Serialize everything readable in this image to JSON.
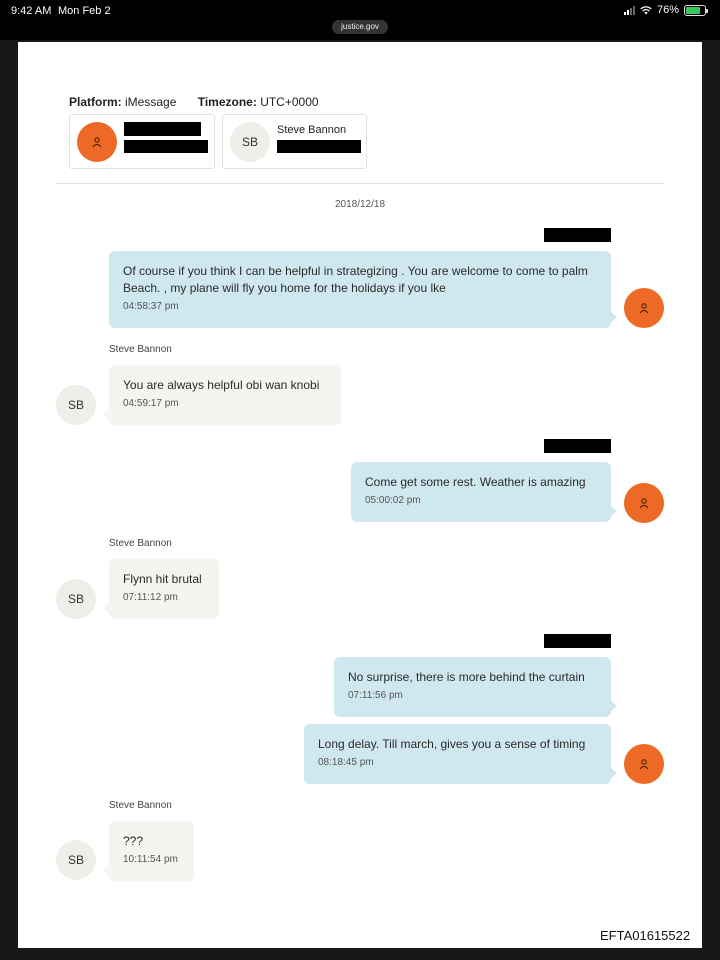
{
  "status_bar": {
    "time": "9:42 AM",
    "date": "Mon Feb 2",
    "url": "justice.gov",
    "battery": "76%",
    "battery_level": 0.76
  },
  "header": {
    "platform_label": "Platform:",
    "platform_value": "iMessage",
    "timezone_label": "Timezone:",
    "timezone_value": "UTC+0000"
  },
  "participants": [
    {
      "initials": "",
      "name": ""
    },
    {
      "initials": "SB",
      "name": "Steve Bannon"
    }
  ],
  "conversation_date": "2018/12/18",
  "messages": [
    {
      "direction": "outgoing",
      "sender": "",
      "text": "Of course if you think I can be helpful in strategizing .  You are welcome to come to palm Beach. , my plane will fly you home for the holidays if you lke",
      "time": "04:58:37 pm"
    },
    {
      "direction": "incoming",
      "sender": "Steve Bannon",
      "text": "You are always helpful obi wan knobi",
      "time": "04:59:17 pm",
      "initials": "SB"
    },
    {
      "direction": "outgoing",
      "sender": "",
      "text": "Come get some rest.    Weather is amazing",
      "time": "05:00:02 pm"
    },
    {
      "direction": "incoming",
      "sender": "Steve Bannon",
      "text": "Flynn hit brutal",
      "time": "07:11:12 pm",
      "initials": "SB"
    },
    {
      "direction": "outgoing",
      "sender": "",
      "text": "No surprise,  there is more behind the curtain",
      "time": "07:11:56 pm"
    },
    {
      "direction": "outgoing",
      "sender": "",
      "text": "Long delay.  Till march,   gives you a sense of timing",
      "time": "08:18:45 pm"
    },
    {
      "direction": "incoming",
      "sender": "Steve Bannon",
      "text": "???",
      "time": "10:11:54 pm",
      "initials": "SB"
    }
  ],
  "document_id": "EFTA01615522",
  "colors": {
    "outgoing_bubble": "#cfe8ef",
    "incoming_bubble": "#f5f4f0",
    "me_avatar": "#ed6a26",
    "sb_avatar": "#f0eee8"
  }
}
